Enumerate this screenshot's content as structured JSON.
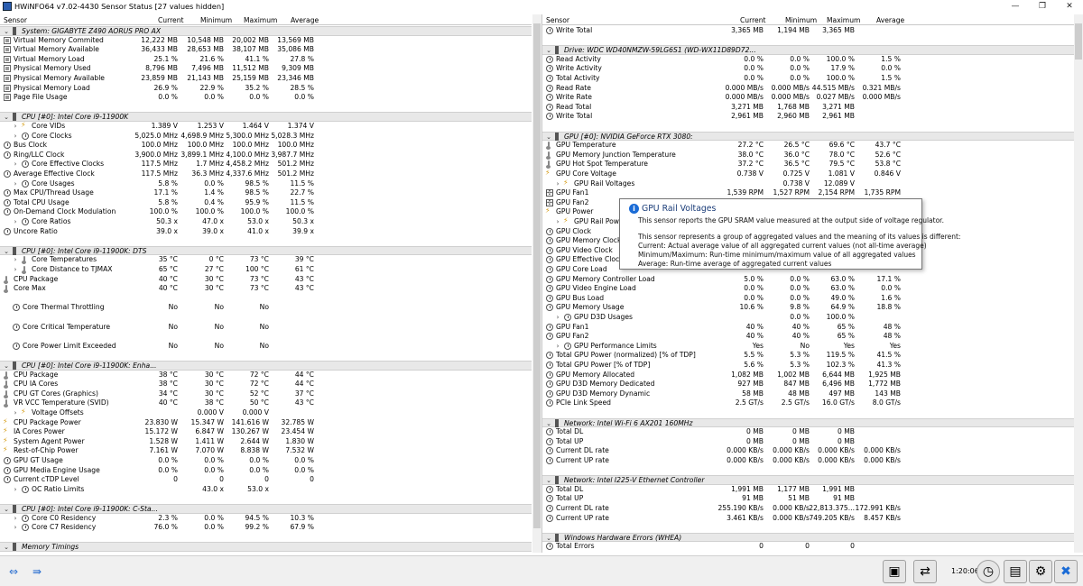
{
  "window": {
    "title": "HWiNFO64 v7.02-4430 Sensor Status [27 values hidden]",
    "minimize_glyph": "—",
    "maximize_glyph": "❐",
    "close_glyph": "✕"
  },
  "columns": {
    "sensor": "Sensor",
    "current": "Current",
    "minimum": "Minimum",
    "maximum": "Maximum",
    "average": "Average"
  },
  "left_rows": [
    {
      "t": "grp",
      "exp": "⌄",
      "label": "System: GIGABYTE Z490 AORUS PRO AX"
    },
    {
      "t": "item",
      "icon": "mem",
      "label": "Virtual Memory Commited",
      "cur": "12,222 MB",
      "min": "10,548 MB",
      "max": "20,002 MB",
      "avg": "13,569 MB"
    },
    {
      "t": "item",
      "icon": "mem",
      "label": "Virtual Memory Available",
      "cur": "36,433 MB",
      "min": "28,653 MB",
      "max": "38,107 MB",
      "avg": "35,086 MB"
    },
    {
      "t": "item",
      "icon": "mem",
      "label": "Virtual Memory Load",
      "cur": "25.1 %",
      "min": "21.6 %",
      "max": "41.1 %",
      "avg": "27.8 %"
    },
    {
      "t": "item",
      "icon": "mem",
      "label": "Physical Memory Used",
      "cur": "8,796 MB",
      "min": "7,496 MB",
      "max": "11,512 MB",
      "avg": "9,309 MB"
    },
    {
      "t": "item",
      "icon": "mem",
      "label": "Physical Memory Available",
      "cur": "23,859 MB",
      "min": "21,143 MB",
      "max": "25,159 MB",
      "avg": "23,346 MB"
    },
    {
      "t": "item",
      "icon": "mem",
      "label": "Physical Memory Load",
      "cur": "26.9 %",
      "min": "22.9 %",
      "max": "35.2 %",
      "avg": "28.5 %"
    },
    {
      "t": "item",
      "icon": "mem",
      "label": "Page File Usage",
      "cur": "0.0 %",
      "min": "0.0 %",
      "max": "0.0 %",
      "avg": "0.0 %"
    },
    {
      "t": "blank"
    },
    {
      "t": "grp",
      "exp": "⌄",
      "label": "CPU [#0]: Intel Core i9-11900K"
    },
    {
      "t": "item",
      "exp": "›",
      "ind": 1,
      "icon": "volt",
      "label": "Core VIDs",
      "cur": "1.389 V",
      "min": "1.253 V",
      "max": "1.464 V",
      "avg": "1.374 V"
    },
    {
      "t": "item",
      "exp": "›",
      "ind": 1,
      "icon": "clock",
      "label": "Core Clocks",
      "cur": "5,025.0 MHz",
      "min": "4,698.9 MHz",
      "max": "5,300.0 MHz",
      "avg": "5,028.3 MHz"
    },
    {
      "t": "item",
      "icon": "clock",
      "label": "Bus Clock",
      "cur": "100.0 MHz",
      "min": "100.0 MHz",
      "max": "100.0 MHz",
      "avg": "100.0 MHz"
    },
    {
      "t": "item",
      "icon": "clock",
      "label": "Ring/LLC Clock",
      "cur": "3,900.0 MHz",
      "min": "3,899.1 MHz",
      "max": "4,100.0 MHz",
      "avg": "3,987.7 MHz"
    },
    {
      "t": "item",
      "exp": "›",
      "ind": 1,
      "icon": "clock",
      "label": "Core Effective Clocks",
      "cur": "117.5 MHz",
      "min": "1.7 MHz",
      "max": "4,458.2 MHz",
      "avg": "501.2 MHz"
    },
    {
      "t": "item",
      "icon": "clock",
      "label": "Average Effective Clock",
      "cur": "117.5 MHz",
      "min": "36.3 MHz",
      "max": "4,337.6 MHz",
      "avg": "501.2 MHz"
    },
    {
      "t": "item",
      "exp": "›",
      "ind": 1,
      "icon": "clock",
      "label": "Core Usages",
      "cur": "5.8 %",
      "min": "0.0 %",
      "max": "98.5 %",
      "avg": "11.5 %"
    },
    {
      "t": "item",
      "icon": "clock",
      "label": "Max CPU/Thread Usage",
      "cur": "17.1 %",
      "min": "1.4 %",
      "max": "98.5 %",
      "avg": "22.7 %"
    },
    {
      "t": "item",
      "icon": "clock",
      "label": "Total CPU Usage",
      "cur": "5.8 %",
      "min": "0.4 %",
      "max": "95.9 %",
      "avg": "11.5 %"
    },
    {
      "t": "item",
      "icon": "clock",
      "label": "On-Demand Clock Modulation",
      "cur": "100.0 %",
      "min": "100.0 %",
      "max": "100.0 %",
      "avg": "100.0 %"
    },
    {
      "t": "item",
      "exp": "›",
      "ind": 1,
      "icon": "clock",
      "label": "Core Ratios",
      "cur": "50.3 x",
      "min": "47.0 x",
      "max": "53.0 x",
      "avg": "50.3 x"
    },
    {
      "t": "item",
      "icon": "clock",
      "label": "Uncore Ratio",
      "cur": "39.0 x",
      "min": "39.0 x",
      "max": "41.0 x",
      "avg": "39.9 x"
    },
    {
      "t": "blank"
    },
    {
      "t": "grp",
      "exp": "⌄",
      "label": "CPU [#0]: Intel Core i9-11900K: DTS"
    },
    {
      "t": "item",
      "exp": "›",
      "ind": 1,
      "icon": "therm",
      "label": "Core Temperatures",
      "cur": "35 °C",
      "min": "0 °C",
      "max": "73 °C",
      "avg": "39 °C"
    },
    {
      "t": "item",
      "exp": "›",
      "ind": 1,
      "icon": "therm",
      "label": "Core Distance to TJMAX",
      "cur": "65 °C",
      "min": "27 °C",
      "max": "100 °C",
      "avg": "61 °C"
    },
    {
      "t": "item",
      "icon": "therm",
      "label": "CPU Package",
      "cur": "40 °C",
      "min": "30 °C",
      "max": "73 °C",
      "avg": "43 °C"
    },
    {
      "t": "item",
      "icon": "therm",
      "label": "Core Max",
      "cur": "40 °C",
      "min": "30 °C",
      "max": "73 °C",
      "avg": "43 °C"
    },
    {
      "t": "blank"
    },
    {
      "t": "item",
      "ind": 1,
      "icon": "clock",
      "label": "Core Thermal Throttling",
      "cur": "No",
      "min": "No",
      "max": "No",
      "avg": ""
    },
    {
      "t": "blank"
    },
    {
      "t": "item",
      "ind": 1,
      "icon": "clock",
      "label": "Core Critical Temperature",
      "cur": "No",
      "min": "No",
      "max": "No",
      "avg": ""
    },
    {
      "t": "blank"
    },
    {
      "t": "item",
      "ind": 1,
      "icon": "clock",
      "label": "Core Power Limit Exceeded",
      "cur": "No",
      "min": "No",
      "max": "No",
      "avg": ""
    },
    {
      "t": "blank"
    },
    {
      "t": "grp",
      "exp": "⌄",
      "label": "CPU [#0]: Intel Core i9-11900K: Enha..."
    },
    {
      "t": "item",
      "icon": "therm",
      "label": "CPU Package",
      "cur": "38 °C",
      "min": "30 °C",
      "max": "72 °C",
      "avg": "44 °C"
    },
    {
      "t": "item",
      "icon": "therm",
      "label": "CPU IA Cores",
      "cur": "38 °C",
      "min": "30 °C",
      "max": "72 °C",
      "avg": "44 °C"
    },
    {
      "t": "item",
      "icon": "therm",
      "label": "CPU GT Cores (Graphics)",
      "cur": "34 °C",
      "min": "30 °C",
      "max": "52 °C",
      "avg": "37 °C"
    },
    {
      "t": "item",
      "icon": "therm",
      "label": "VR VCC Temperature (SVID)",
      "cur": "40 °C",
      "min": "38 °C",
      "max": "50 °C",
      "avg": "43 °C"
    },
    {
      "t": "item",
      "exp": "›",
      "ind": 1,
      "icon": "volt",
      "label": "Voltage Offsets",
      "cur": "",
      "min": "0.000 V",
      "max": "0.000 V",
      "avg": ""
    },
    {
      "t": "item",
      "icon": "volt",
      "label": "CPU Package Power",
      "cur": "23.830 W",
      "min": "15.347 W",
      "max": "141.616 W",
      "avg": "32.785 W"
    },
    {
      "t": "item",
      "icon": "volt",
      "label": "IA Cores Power",
      "cur": "15.172 W",
      "min": "6.847 W",
      "max": "130.267 W",
      "avg": "23.454 W"
    },
    {
      "t": "item",
      "icon": "volt",
      "label": "System Agent Power",
      "cur": "1.528 W",
      "min": "1.411 W",
      "max": "2.644 W",
      "avg": "1.830 W"
    },
    {
      "t": "item",
      "icon": "volt",
      "label": "Rest-of-Chip Power",
      "cur": "7.161 W",
      "min": "7.070 W",
      "max": "8.838 W",
      "avg": "7.532 W"
    },
    {
      "t": "item",
      "icon": "clock",
      "label": "GPU GT Usage",
      "cur": "0.0 %",
      "min": "0.0 %",
      "max": "0.0 %",
      "avg": "0.0 %"
    },
    {
      "t": "item",
      "icon": "clock",
      "label": "GPU Media Engine Usage",
      "cur": "0.0 %",
      "min": "0.0 %",
      "max": "0.0 %",
      "avg": "0.0 %"
    },
    {
      "t": "item",
      "icon": "clock",
      "label": "Current cTDP Level",
      "cur": "0",
      "min": "0",
      "max": "0",
      "avg": "0"
    },
    {
      "t": "item",
      "exp": "›",
      "ind": 1,
      "icon": "clock",
      "label": "OC Ratio Limits",
      "cur": "",
      "min": "43.0 x",
      "max": "53.0 x",
      "avg": ""
    },
    {
      "t": "blank"
    },
    {
      "t": "grp",
      "exp": "⌄",
      "label": "CPU [#0]: Intel Core i9-11900K: C-Sta..."
    },
    {
      "t": "item",
      "exp": "›",
      "ind": 1,
      "icon": "clock",
      "label": "Core C0 Residency",
      "cur": "2.3 %",
      "min": "0.0 %",
      "max": "94.5 %",
      "avg": "10.3 %"
    },
    {
      "t": "item",
      "exp": "›",
      "ind": 1,
      "icon": "clock",
      "label": "Core C7 Residency",
      "cur": "76.0 %",
      "min": "0.0 %",
      "max": "99.2 %",
      "avg": "67.9 %"
    },
    {
      "t": "blank"
    },
    {
      "t": "grp",
      "exp": "⌄",
      "label": "Memory Timings"
    }
  ],
  "right_rows": [
    {
      "t": "item",
      "icon": "clock",
      "label": "Write Total",
      "cur": "3,365 MB",
      "min": "1,194 MB",
      "max": "3,365 MB",
      "avg": ""
    },
    {
      "t": "blank"
    },
    {
      "t": "grp",
      "exp": "⌄",
      "label": "Drive: WDC WD40NMZW-59LG6S1 (WD-WX11D89D72..."
    },
    {
      "t": "item",
      "icon": "clock",
      "label": "Read Activity",
      "cur": "0.0 %",
      "min": "0.0 %",
      "max": "100.0 %",
      "avg": "1.5 %"
    },
    {
      "t": "item",
      "icon": "clock",
      "label": "Write Activity",
      "cur": "0.0 %",
      "min": "0.0 %",
      "max": "17.9 %",
      "avg": "0.0 %"
    },
    {
      "t": "item",
      "icon": "clock",
      "label": "Total Activity",
      "cur": "0.0 %",
      "min": "0.0 %",
      "max": "100.0 %",
      "avg": "1.5 %"
    },
    {
      "t": "item",
      "icon": "clock",
      "label": "Read Rate",
      "cur": "0.000 MB/s",
      "min": "0.000 MB/s",
      "max": "44.515 MB/s",
      "avg": "0.321 MB/s"
    },
    {
      "t": "item",
      "icon": "clock",
      "label": "Write Rate",
      "cur": "0.000 MB/s",
      "min": "0.000 MB/s",
      "max": "0.027 MB/s",
      "avg": "0.000 MB/s"
    },
    {
      "t": "item",
      "icon": "clock",
      "label": "Read Total",
      "cur": "3,271 MB",
      "min": "1,768 MB",
      "max": "3,271 MB",
      "avg": ""
    },
    {
      "t": "item",
      "icon": "clock",
      "label": "Write Total",
      "cur": "2,961 MB",
      "min": "2,960 MB",
      "max": "2,961 MB",
      "avg": ""
    },
    {
      "t": "blank"
    },
    {
      "t": "grp",
      "exp": "⌄",
      "label": "GPU [#0]: NVIDIA GeForce RTX 3080:"
    },
    {
      "t": "item",
      "icon": "therm",
      "label": "GPU Temperature",
      "cur": "27.2 °C",
      "min": "26.5 °C",
      "max": "69.6 °C",
      "avg": "43.7 °C"
    },
    {
      "t": "item",
      "icon": "therm",
      "label": "GPU Memory Junction Temperature",
      "cur": "38.0 °C",
      "min": "36.0 °C",
      "max": "78.0 °C",
      "avg": "52.6 °C"
    },
    {
      "t": "item",
      "icon": "therm",
      "label": "GPU Hot Spot Temperature",
      "cur": "37.2 °C",
      "min": "36.5 °C",
      "max": "79.5 °C",
      "avg": "53.8 °C"
    },
    {
      "t": "item",
      "icon": "volt",
      "label": "GPU Core Voltage",
      "cur": "0.738 V",
      "min": "0.725 V",
      "max": "1.081 V",
      "avg": "0.846 V"
    },
    {
      "t": "item",
      "exp": "›",
      "ind": 1,
      "icon": "volt",
      "label": "GPU Rail Voltages",
      "cur": "",
      "min": "0.738 V",
      "max": "12.089 V",
      "avg": ""
    },
    {
      "t": "item",
      "icon": "fan",
      "label": "GPU Fan1",
      "cur": "1,539 RPM",
      "min": "1,527 RPM",
      "max": "2,154 RPM",
      "avg": "1,735 RPM"
    },
    {
      "t": "item",
      "icon": "fan",
      "label": "GPU Fan2",
      "cur": "",
      "min": "",
      "max": "",
      "avg": ""
    },
    {
      "t": "item",
      "icon": "volt",
      "label": "GPU Power",
      "cur": "",
      "min": "",
      "max": "",
      "avg": ""
    },
    {
      "t": "item",
      "exp": "›",
      "ind": 1,
      "icon": "volt",
      "label": "GPU Rail Powers",
      "cur": "",
      "min": "",
      "max": "",
      "avg": ""
    },
    {
      "t": "item",
      "icon": "clock",
      "label": "GPU Clock",
      "cur": "",
      "min": "",
      "max": "",
      "avg": ""
    },
    {
      "t": "item",
      "icon": "clock",
      "label": "GPU Memory Clock",
      "cur": "",
      "min": "",
      "max": "",
      "avg": ""
    },
    {
      "t": "item",
      "icon": "clock",
      "label": "GPU Video Clock",
      "cur": "",
      "min": "",
      "max": "",
      "avg": ""
    },
    {
      "t": "item",
      "icon": "clock",
      "label": "GPU Effective Clock",
      "cur": "",
      "min": "",
      "max": "",
      "avg": ""
    },
    {
      "t": "item",
      "icon": "clock",
      "label": "GPU Core Load",
      "cur": "",
      "min": "",
      "max": "",
      "avg": ""
    },
    {
      "t": "item",
      "icon": "clock",
      "label": "GPU Memory Controller Load",
      "cur": "5.0 %",
      "min": "0.0 %",
      "max": "63.0 %",
      "avg": "17.1 %"
    },
    {
      "t": "item",
      "icon": "clock",
      "label": "GPU Video Engine Load",
      "cur": "0.0 %",
      "min": "0.0 %",
      "max": "63.0 %",
      "avg": "0.0 %"
    },
    {
      "t": "item",
      "icon": "clock",
      "label": "GPU Bus Load",
      "cur": "0.0 %",
      "min": "0.0 %",
      "max": "49.0 %",
      "avg": "1.6 %"
    },
    {
      "t": "item",
      "icon": "clock",
      "label": "GPU Memory Usage",
      "cur": "10.6 %",
      "min": "9.8 %",
      "max": "64.9 %",
      "avg": "18.8 %"
    },
    {
      "t": "item",
      "exp": "›",
      "ind": 1,
      "icon": "clock",
      "label": "GPU D3D Usages",
      "cur": "",
      "min": "0.0 %",
      "max": "100.0 %",
      "avg": ""
    },
    {
      "t": "item",
      "icon": "clock",
      "label": "GPU Fan1",
      "cur": "40 %",
      "min": "40 %",
      "max": "65 %",
      "avg": "48 %"
    },
    {
      "t": "item",
      "icon": "clock",
      "label": "GPU Fan2",
      "cur": "40 %",
      "min": "40 %",
      "max": "65 %",
      "avg": "48 %"
    },
    {
      "t": "item",
      "exp": "›",
      "ind": 1,
      "icon": "clock",
      "label": "GPU Performance Limits",
      "cur": "Yes",
      "min": "No",
      "max": "Yes",
      "avg": "Yes"
    },
    {
      "t": "item",
      "icon": "clock",
      "label": "Total GPU Power (normalized) [% of TDP]",
      "cur": "5.5 %",
      "min": "5.3 %",
      "max": "119.5 %",
      "avg": "41.5 %"
    },
    {
      "t": "item",
      "icon": "clock",
      "label": "Total GPU Power [% of TDP]",
      "cur": "5.6 %",
      "min": "5.3 %",
      "max": "102.3 %",
      "avg": "41.3 %"
    },
    {
      "t": "item",
      "icon": "clock",
      "label": "GPU Memory Allocated",
      "cur": "1,082 MB",
      "min": "1,002 MB",
      "max": "6,644 MB",
      "avg": "1,925 MB"
    },
    {
      "t": "item",
      "icon": "clock",
      "label": "GPU D3D Memory Dedicated",
      "cur": "927 MB",
      "min": "847 MB",
      "max": "6,496 MB",
      "avg": "1,772 MB"
    },
    {
      "t": "item",
      "icon": "clock",
      "label": "GPU D3D Memory Dynamic",
      "cur": "58 MB",
      "min": "48 MB",
      "max": "497 MB",
      "avg": "143 MB"
    },
    {
      "t": "item",
      "icon": "clock",
      "label": "PCIe Link Speed",
      "cur": "2.5 GT/s",
      "min": "2.5 GT/s",
      "max": "16.0 GT/s",
      "avg": "8.0 GT/s"
    },
    {
      "t": "blank"
    },
    {
      "t": "grp",
      "exp": "⌄",
      "label": "Network: Intel Wi-Fi 6 AX201 160MHz"
    },
    {
      "t": "item",
      "icon": "clock",
      "label": "Total DL",
      "cur": "0 MB",
      "min": "0 MB",
      "max": "0 MB",
      "avg": ""
    },
    {
      "t": "item",
      "icon": "clock",
      "label": "Total UP",
      "cur": "0 MB",
      "min": "0 MB",
      "max": "0 MB",
      "avg": ""
    },
    {
      "t": "item",
      "icon": "clock",
      "label": "Current DL rate",
      "cur": "0.000 KB/s",
      "min": "0.000 KB/s",
      "max": "0.000 KB/s",
      "avg": "0.000 KB/s"
    },
    {
      "t": "item",
      "icon": "clock",
      "label": "Current UP rate",
      "cur": "0.000 KB/s",
      "min": "0.000 KB/s",
      "max": "0.000 KB/s",
      "avg": "0.000 KB/s"
    },
    {
      "t": "blank"
    },
    {
      "t": "grp",
      "exp": "⌄",
      "label": "Network: Intel I225-V Ethernet Controller"
    },
    {
      "t": "item",
      "icon": "clock",
      "label": "Total DL",
      "cur": "1,991 MB",
      "min": "1,177 MB",
      "max": "1,991 MB",
      "avg": ""
    },
    {
      "t": "item",
      "icon": "clock",
      "label": "Total UP",
      "cur": "91 MB",
      "min": "51 MB",
      "max": "91 MB",
      "avg": ""
    },
    {
      "t": "item",
      "icon": "clock",
      "label": "Current DL rate",
      "cur": "255.190 KB/s",
      "min": "0.000 KB/s",
      "max": "22,813.375...",
      "avg": "172.991 KB/s"
    },
    {
      "t": "item",
      "icon": "clock",
      "label": "Current UP rate",
      "cur": "3.461 KB/s",
      "min": "0.000 KB/s",
      "max": "749.205 KB/s",
      "avg": "8.457 KB/s"
    },
    {
      "t": "blank"
    },
    {
      "t": "grp",
      "exp": "⌄",
      "label": "Windows Hardware Errors (WHEA)"
    },
    {
      "t": "item",
      "icon": "clock",
      "label": "Total Errors",
      "cur": "0",
      "min": "0",
      "max": "0",
      "avg": ""
    }
  ],
  "tooltip": {
    "title": "GPU Rail Voltages",
    "line1": "This sensor reports the GPU SRAM value measured at the output side of voltage regulator.",
    "line2": "This sensor represents a group of aggregated values and the meaning of its values is different:",
    "line3": "Current: Actual average value of all aggregated current values (not all-time average)",
    "line4": "Minimum/Maximum: Run-time minimum/maximum value of all aggregated values",
    "line5": "Average: Run-time average of aggregated current values"
  },
  "statusbar": {
    "left_arrows": "⇔",
    "right_arrows": "⇛",
    "timer": "1:20:06"
  }
}
